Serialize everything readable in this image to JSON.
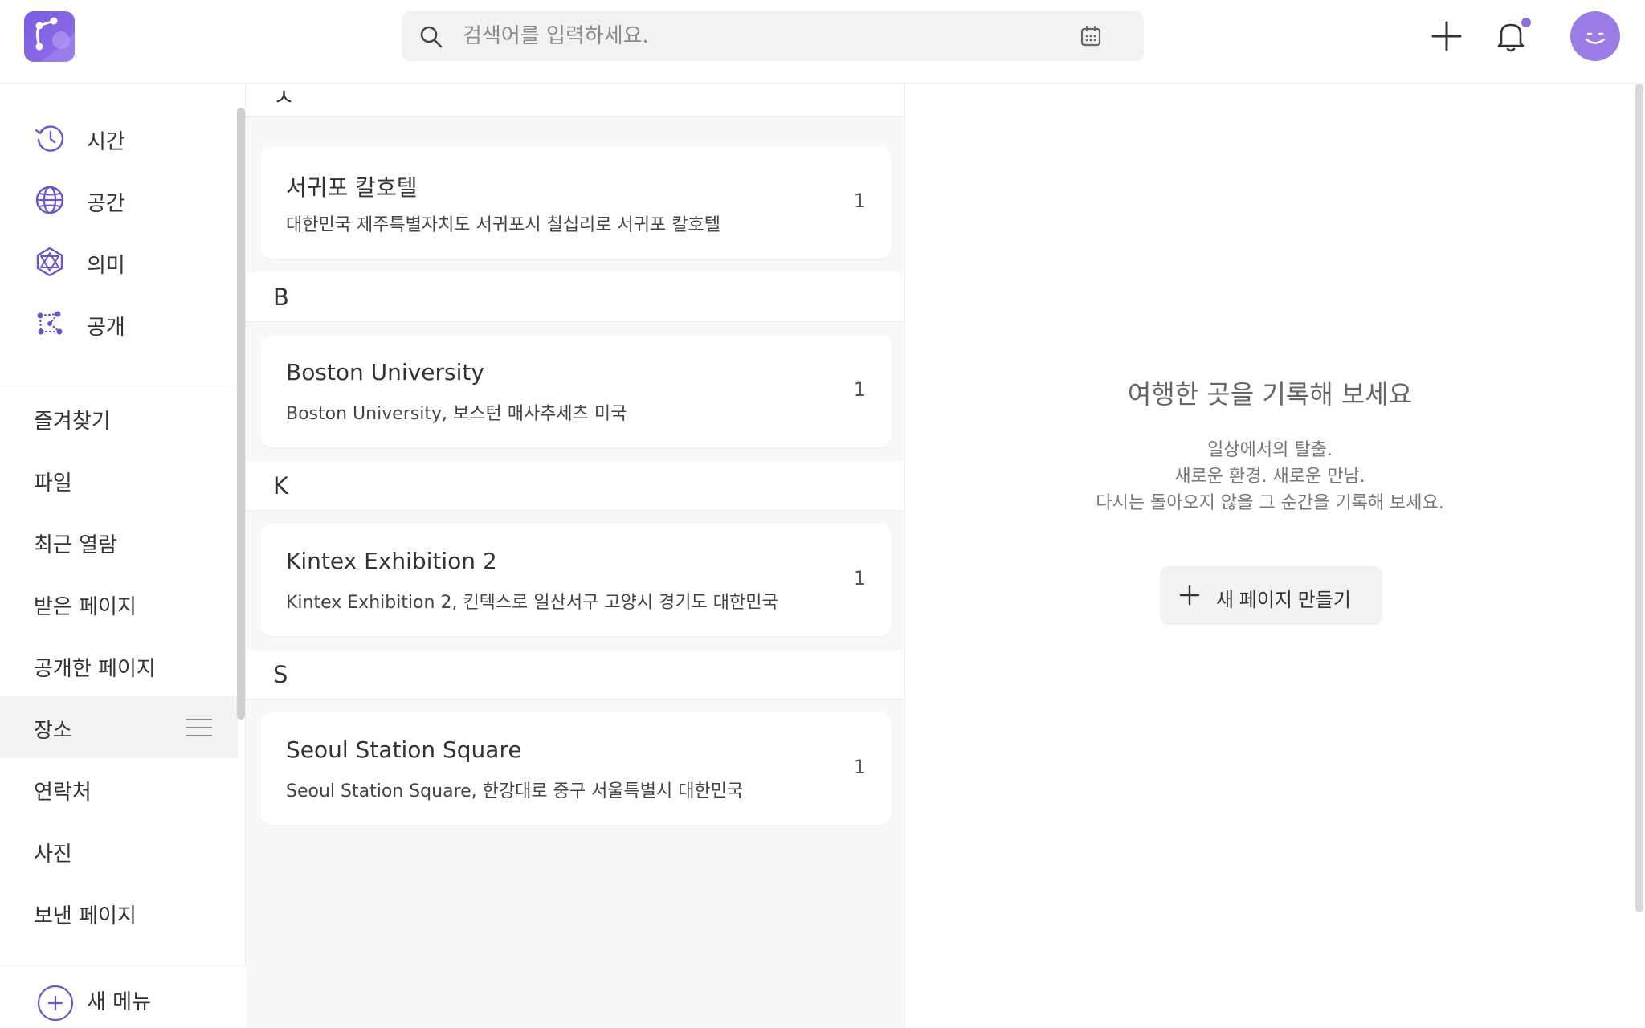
{
  "header": {
    "search_placeholder": "검색어를 입력하세요.",
    "icons": {
      "logo": "app-logo",
      "search": "search-icon",
      "calendar": "calendar-icon",
      "add": "plus-icon",
      "notifications": "bell-icon",
      "avatar": "smiley-avatar"
    },
    "colors": {
      "accent": "#8c6fe0"
    }
  },
  "sidebar": {
    "top_items": [
      {
        "label": "시간",
        "icon": "clock-history-icon"
      },
      {
        "label": "공간",
        "icon": "globe-icon"
      },
      {
        "label": "의미",
        "icon": "meaning-network-icon"
      },
      {
        "label": "공개",
        "icon": "share-network-icon"
      }
    ],
    "menu_items": [
      {
        "label": "즐겨찾기"
      },
      {
        "label": "파일"
      },
      {
        "label": "최근 열람"
      },
      {
        "label": "받은 페이지"
      },
      {
        "label": "공개한 페이지"
      },
      {
        "label": "장소",
        "active": true
      },
      {
        "label": "연락처"
      },
      {
        "label": "사진"
      },
      {
        "label": "보낸 페이지"
      }
    ],
    "new_menu_label": "새 메뉴"
  },
  "places": {
    "groups": [
      {
        "letter": "ㅅ",
        "items": [
          {
            "title": "서귀포 칼호텔",
            "subtitle": "대한민국 제주특별자치도 서귀포시 칠십리로 서귀포 칼호텔",
            "count": "1"
          }
        ]
      },
      {
        "letter": "B",
        "items": [
          {
            "title": "Boston University",
            "subtitle": "Boston University, 보스턴 매사추세츠 미국",
            "count": "1"
          }
        ]
      },
      {
        "letter": "K",
        "items": [
          {
            "title": "Kintex Exhibition 2",
            "subtitle": "Kintex Exhibition 2, 킨텍스로 일산서구 고양시 경기도 대한민국",
            "count": "1"
          }
        ]
      },
      {
        "letter": "S",
        "items": [
          {
            "title": "Seoul Station Square",
            "subtitle": "Seoul Station Square, 한강대로 중구 서울특별시 대한민국",
            "count": "1"
          }
        ]
      }
    ]
  },
  "empty_state": {
    "title": "여행한 곳을 기록해 보세요",
    "lines": [
      "일상에서의 탈출.",
      "새로운 환경. 새로운 만남.",
      "다시는 돌아오지 않을 그 순간을 기록해 보세요."
    ],
    "button_label": "새 페이지 만들기"
  }
}
